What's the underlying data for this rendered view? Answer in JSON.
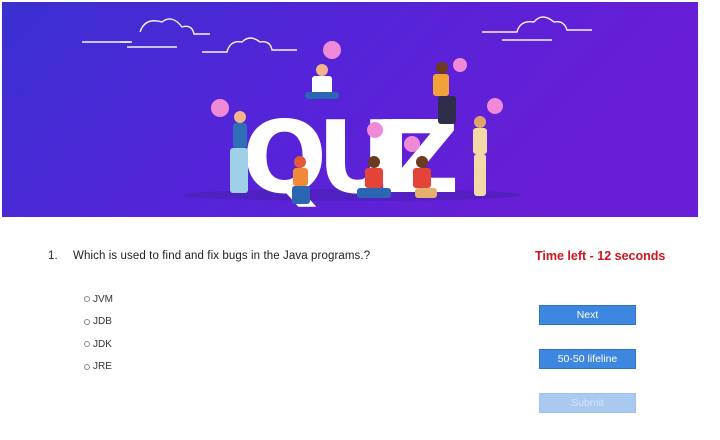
{
  "banner": {
    "title_letters": [
      "Q",
      "U",
      "I",
      "Z"
    ],
    "colors": {
      "gradient_start": "#3c2fd6",
      "gradient_end": "#6a1dd6",
      "letters": "#ffffff"
    }
  },
  "question": {
    "number": "1.",
    "text": "Which is used to find and fix bugs in the Java programs.?"
  },
  "timer": {
    "text": "Time left - 12 seconds",
    "color": "#d0141b"
  },
  "options": [
    {
      "label": "JVM",
      "selected": false
    },
    {
      "label": "JDB",
      "selected": false
    },
    {
      "label": "JDK",
      "selected": false
    },
    {
      "label": "JRE",
      "selected": false
    }
  ],
  "buttons": {
    "next": "Next",
    "fifty_fifty": "50-50 lifeline",
    "submit": "Submit",
    "submit_disabled": true
  }
}
